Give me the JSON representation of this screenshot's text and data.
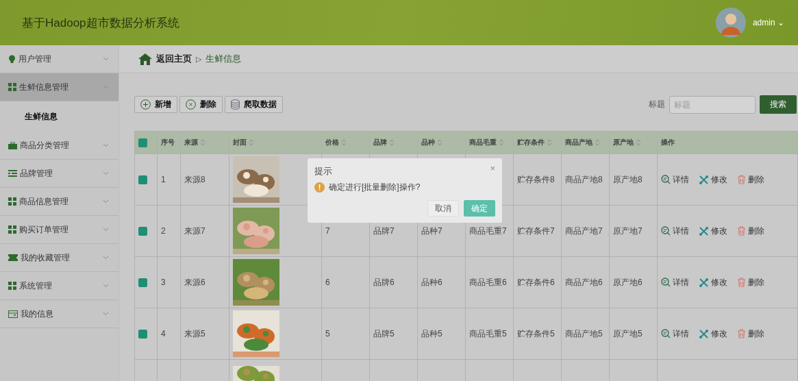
{
  "header": {
    "title": "基于Hadoop超市数据分析系统",
    "user": "admin",
    "user_caret": "⌄"
  },
  "sidebar": {
    "items": [
      {
        "label": "用户管理",
        "expanded": false,
        "selected": false
      },
      {
        "label": "生鲜信息管理",
        "expanded": true,
        "selected": true,
        "children": [
          {
            "label": "生鲜信息",
            "selected": true
          }
        ]
      },
      {
        "label": "商品分类管理",
        "expanded": false,
        "selected": false
      },
      {
        "label": "品牌管理",
        "expanded": false,
        "selected": false
      },
      {
        "label": "商品信息管理",
        "expanded": false,
        "selected": false
      },
      {
        "label": "购买订单管理",
        "expanded": false,
        "selected": false
      },
      {
        "label": "我的收藏管理",
        "expanded": false,
        "selected": false
      },
      {
        "label": "系统管理",
        "expanded": false,
        "selected": false
      },
      {
        "label": "我的信息",
        "expanded": false,
        "selected": false
      }
    ]
  },
  "breadcrumb": {
    "home": "返回主页",
    "separator": "▷",
    "current": "生鲜信息"
  },
  "toolbar": {
    "buttons": [
      {
        "kind": "add",
        "label": "新增"
      },
      {
        "kind": "delete",
        "label": "删除"
      },
      {
        "kind": "crawl",
        "label": "爬取数据"
      }
    ],
    "search": {
      "label": "标题",
      "placeholder": "标题",
      "button": "搜索"
    }
  },
  "table": {
    "all_checked": true,
    "columns": [
      {
        "label": "序号",
        "sortable": false
      },
      {
        "label": "来源",
        "sortable": true
      },
      {
        "label": "封面",
        "sortable": true
      },
      {
        "label": "价格",
        "sortable": true
      },
      {
        "label": "品牌",
        "sortable": true
      },
      {
        "label": "品种",
        "sortable": true
      },
      {
        "label": "商品毛重",
        "sortable": true
      },
      {
        "label": "贮存条件",
        "sortable": true
      },
      {
        "label": "商品产地",
        "sortable": true
      },
      {
        "label": "原产地",
        "sortable": true
      },
      {
        "label": "操作",
        "sortable": false
      }
    ],
    "rows": [
      {
        "checked": true,
        "cells": [
          "1",
          "来源8",
          {
            "kind": "picture"
          },
          null,
          null,
          null,
          null,
          "贮存条件8",
          "商品产地8",
          "原产地8"
        ],
        "actions": [
          "详情",
          "修改",
          "删除"
        ]
      },
      {
        "checked": true,
        "cells": [
          "2",
          "来源7",
          {
            "kind": "picture"
          },
          "7",
          "品牌7",
          "品种7",
          "商品毛重7",
          "贮存条件7",
          "商品产地7",
          "原产地7"
        ],
        "actions": [
          "详情",
          "修改",
          "删除"
        ]
      },
      {
        "checked": true,
        "cells": [
          "3",
          "来源6",
          {
            "kind": "picture"
          },
          "6",
          "品牌6",
          "品种6",
          "商品毛重6",
          "贮存条件6",
          "商品产地6",
          "原产地6"
        ],
        "actions": [
          "详情",
          "修改",
          "删除"
        ]
      },
      {
        "checked": true,
        "cells": [
          "4",
          "来源5",
          {
            "kind": "picture"
          },
          "5",
          "品牌5",
          "品种5",
          "商品毛重5",
          "贮存条件5",
          "商品产地5",
          "原产地5"
        ],
        "actions": [
          "详情",
          "修改",
          "删除"
        ]
      }
    ],
    "partial_row": {
      "cover": {
        "kind": "picture"
      }
    }
  },
  "dialog": {
    "title": "提示",
    "close": "×",
    "message": "确定进行[批量删除]操作?",
    "buttons": [
      {
        "kind": "cancel",
        "label": "取消"
      },
      {
        "kind": "confirm",
        "label": "确定"
      }
    ]
  }
}
